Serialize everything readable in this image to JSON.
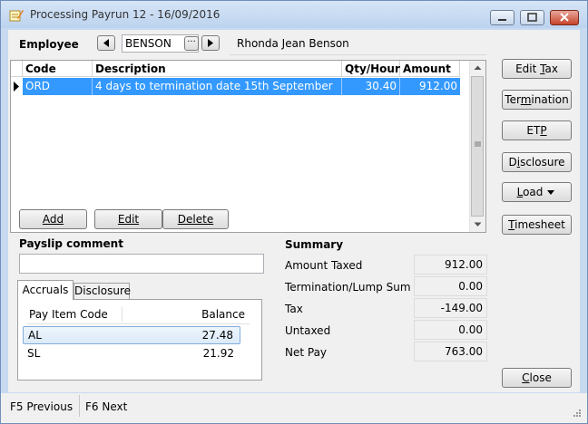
{
  "window": {
    "title": "Processing Payrun 12 - 16/09/2016"
  },
  "employee": {
    "label": "Employee",
    "code": "BENSON",
    "name": "Rhonda Jean Benson",
    "lookup_label": "···"
  },
  "grid": {
    "headers": [
      "Code",
      "Description",
      "Qty/Hours",
      "Amount"
    ],
    "rows": [
      {
        "code": "ORD",
        "description": "4 days to termination date 15th September",
        "qty": "30.40",
        "amount": "912.00"
      }
    ]
  },
  "actions": {
    "add": "Add",
    "edit": "Edit",
    "delete": "Delete"
  },
  "payslip": {
    "label": "Payslip comment",
    "value": ""
  },
  "tabs": {
    "accruals": "Accruals",
    "disclosure": "Disclosure"
  },
  "accruals": {
    "headers": [
      "Pay Item Code",
      "Balance"
    ],
    "rows": [
      {
        "code": "AL",
        "balance": "27.48"
      },
      {
        "code": "SL",
        "balance": "21.92"
      }
    ]
  },
  "summary": {
    "title": "Summary",
    "amount_taxed_label": "Amount Taxed",
    "amount_taxed": "912.00",
    "termination_label": "Termination/Lump Sum",
    "termination": "0.00",
    "tax_label": "Tax",
    "tax": "-149.00",
    "untaxed_label": "Untaxed",
    "untaxed": "0.00",
    "net_label": "Net Pay",
    "net": "763.00"
  },
  "side_buttons": {
    "edit_tax_pre": "Edit ",
    "edit_tax_u": "T",
    "edit_tax_post": "ax",
    "termination_pre": "Ter",
    "termination_u": "m",
    "termination_post": "ination",
    "etp_pre": "ET",
    "etp_u": "P",
    "etp_post": "",
    "disclosure_pre": "D",
    "disclosure_u": "i",
    "disclosure_post": "sclosure",
    "load_pre": "",
    "load_u": "L",
    "load_post": "oad",
    "timesheet_pre": "",
    "timesheet_u": "T",
    "timesheet_post": "imesheet",
    "close_pre": "",
    "close_u": "C",
    "close_post": "lose"
  },
  "status": {
    "prev": "F5 Previous",
    "next": "F6 Next"
  }
}
